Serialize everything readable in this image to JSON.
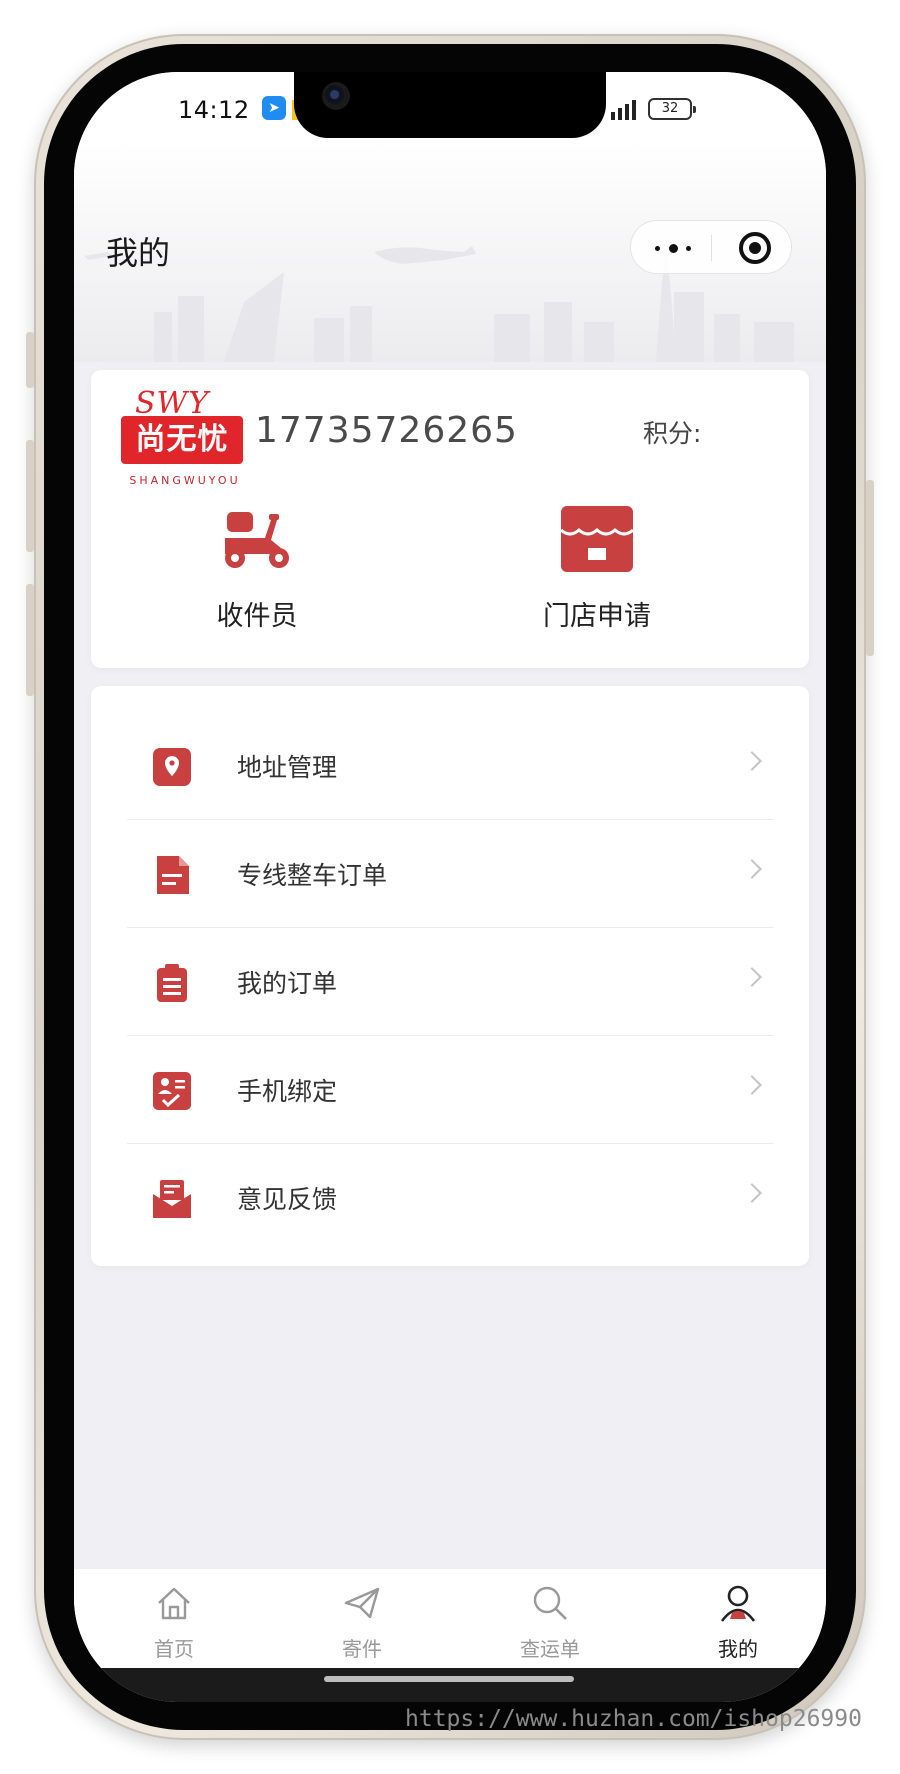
{
  "status_bar": {
    "time": "14:12",
    "battery": "32"
  },
  "header": {
    "title": "我的"
  },
  "profile": {
    "logo_top": "SWY",
    "logo_main": "尚无忧",
    "logo_sub": "SHANGWUYOU",
    "phone": "17735726265",
    "points_label": "积分:"
  },
  "quick_actions": [
    {
      "label": "收件员",
      "icon": "scooter-icon"
    },
    {
      "label": "门店申请",
      "icon": "storefront-icon"
    }
  ],
  "menu": [
    {
      "label": "地址管理",
      "icon": "location-pin-icon"
    },
    {
      "label": "专线整车订单",
      "icon": "document-icon"
    },
    {
      "label": "我的订单",
      "icon": "clipboard-list-icon"
    },
    {
      "label": "手机绑定",
      "icon": "id-check-icon"
    },
    {
      "label": "意见反馈",
      "icon": "feedback-mail-icon"
    }
  ],
  "tabs": [
    {
      "label": "首页",
      "icon": "home-icon",
      "active": false
    },
    {
      "label": "寄件",
      "icon": "paper-plane-icon",
      "active": false
    },
    {
      "label": "查运单",
      "icon": "search-icon",
      "active": false
    },
    {
      "label": "我的",
      "icon": "user-icon",
      "active": true
    }
  ],
  "watermark": "https://www.huzhan.com/ishop26990",
  "colors": {
    "accent": "#c8403f",
    "brand_red": "#e0262a",
    "background": "#f0f0f4"
  }
}
